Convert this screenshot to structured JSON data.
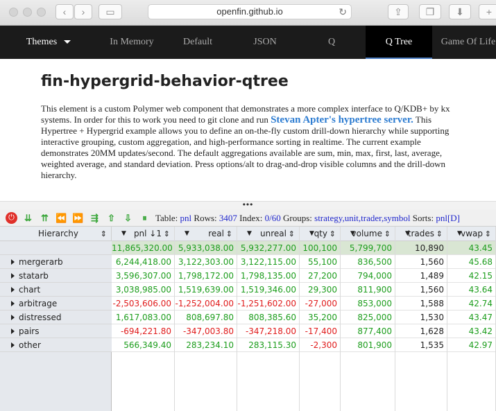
{
  "browser": {
    "url": "openfin.github.io"
  },
  "nav": {
    "themes": "Themes",
    "items": [
      "In Memory",
      "Default",
      "JSON",
      "Q",
      "Q Tree",
      "Game Of Life"
    ]
  },
  "doc": {
    "title": "fin-hypergrid-behavior-qtree",
    "p1": "This element is a custom Polymer web component that demonstrates a more complex interface to Q/KDB+ by kx systems. In order for this to work you need to git clone and run ",
    "link": "Stevan Apter's hypertree server.",
    "p2": " This Hypertree + Hypergrid example allows you to define an on-the-fly custom drill-down hierarchy while supporting interactive grouping, custom aggregation, and high-performance sorting in realtime. The current example demonstrates 20MM updates/second. The default aggregations available are sum, min, max, first, last, average, weighted average, and standard deviation. Press options/alt to drag-and-drop visible columns and the drill-down hierarchy."
  },
  "divider": "•••",
  "toolbar": {
    "table_label": "Table:",
    "table": "pnl",
    "rows_label": "Rows:",
    "rows": "3407",
    "index_label": "Index:",
    "index": "0/60",
    "groups_label": "Groups:",
    "groups": "strategy,unit,trader,symbol",
    "sorts_label": "Sorts:",
    "sorts": "pnl[D]"
  },
  "grid": {
    "headers": [
      "Hierarchy",
      "pnl ↓1",
      "real",
      "unreal",
      "qty",
      "volume",
      "trades",
      "vwap"
    ],
    "total": [
      "11,865,320.00",
      "5,933,038.00",
      "5,932,277.00",
      "100,100",
      "5,799,700",
      "10,890",
      "43.45"
    ],
    "rows": [
      {
        "name": "mergerarb",
        "values": [
          "6,244,418.00",
          "3,122,303.00",
          "3,122,115.00",
          "55,100",
          "836,500",
          "1,560",
          "45.68"
        ]
      },
      {
        "name": "statarb",
        "values": [
          "3,596,307.00",
          "1,798,172.00",
          "1,798,135.00",
          "27,200",
          "794,000",
          "1,489",
          "42.15"
        ]
      },
      {
        "name": "chart",
        "values": [
          "3,038,985.00",
          "1,519,639.00",
          "1,519,346.00",
          "29,300",
          "811,900",
          "1,560",
          "43.64"
        ]
      },
      {
        "name": "arbitrage",
        "values": [
          "-2,503,606.00",
          "-1,252,004.00",
          "-1,251,602.00",
          "-27,000",
          "853,000",
          "1,588",
          "42.74"
        ]
      },
      {
        "name": "distressed",
        "values": [
          "1,617,083.00",
          "808,697.80",
          "808,385.60",
          "35,200",
          "825,000",
          "1,530",
          "43.47"
        ]
      },
      {
        "name": "pairs",
        "values": [
          "-694,221.80",
          "-347,003.80",
          "-347,218.00",
          "-17,400",
          "877,400",
          "1,628",
          "43.42"
        ]
      },
      {
        "name": "other",
        "values": [
          "566,349.40",
          "283,234.10",
          "283,115.30",
          "-2,300",
          "801,900",
          "1,535",
          "42.97"
        ]
      }
    ]
  }
}
